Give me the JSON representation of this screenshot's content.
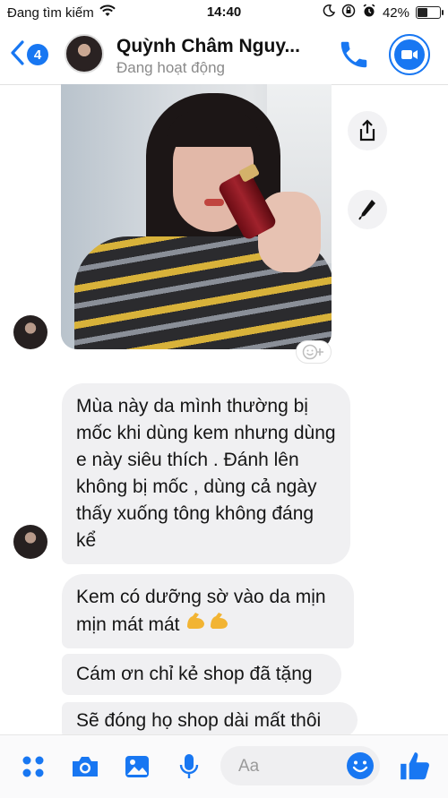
{
  "status_bar": {
    "carrier": "Đang tìm kiếm",
    "time": "14:40",
    "battery": "42%",
    "battery_level": 0.42
  },
  "header": {
    "unread_count": "4",
    "contact_name": "Quỳnh Châm Nguy...",
    "contact_status": "Đang hoạt động"
  },
  "messages": [
    {
      "text": "Mùa này da mình thường bị mốc khi dùng kem nhưng dùng e này siêu thích . Đánh lên không bị mốc , dùng cả ngày thấy xuống tông không đáng kể"
    },
    {
      "text": "Kem có dưỡng sờ vào da mịn mịn mát mát"
    },
    {
      "text": "Cám ơn chỉ kẻ shop đã tặng"
    },
    {
      "text": "Sẽ đóng họ shop dài mất thôi"
    }
  ],
  "composer": {
    "placeholder": "Aa"
  },
  "colors": {
    "accent": "#1877f2",
    "bubble": "#f0f0f2",
    "status_gray": "#8a8a8a"
  },
  "icons": [
    "back-chevron-icon",
    "phone-icon",
    "video-camera-icon",
    "share-icon",
    "pencil-icon",
    "emoji-reaction-icon",
    "apps-icon",
    "camera-icon",
    "gallery-icon",
    "microphone-icon",
    "emoji-icon",
    "thumbs-up-icon"
  ]
}
